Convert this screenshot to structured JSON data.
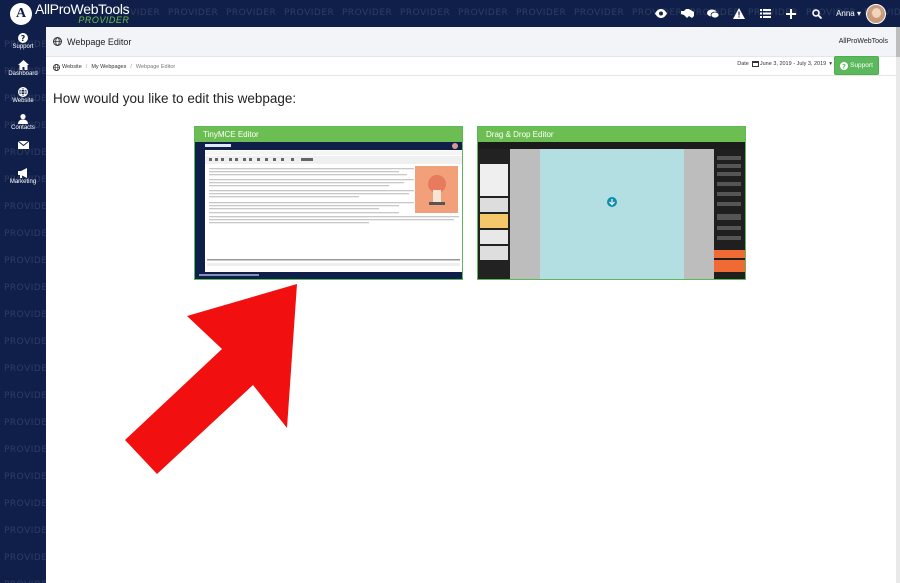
{
  "brand": {
    "name": "AllProWebTools",
    "sub": "PROVIDER",
    "watermark": "PROVIDER"
  },
  "topbar": {
    "icons": [
      "eye-icon",
      "handshake-icon",
      "chat-icon",
      "alert-icon",
      "list-icon",
      "plus-icon",
      "search-icon"
    ],
    "user_name": "Anna"
  },
  "sidebar": {
    "items": [
      {
        "label": "Support",
        "icon": "question-icon"
      },
      {
        "label": "Dashboard",
        "icon": "home-icon"
      },
      {
        "label": "Website",
        "icon": "globe-icon"
      },
      {
        "label": "Contacts",
        "icon": "user-icon"
      },
      {
        "label": "Mail",
        "icon": "envelope-icon"
      },
      {
        "label": "Marketing",
        "icon": "megaphone-icon"
      }
    ]
  },
  "header": {
    "title": "Webpage Editor",
    "brand": "AllProWebTools"
  },
  "breadcrumb": {
    "items": [
      "Website",
      "My Webpages",
      "Webpage Editor"
    ]
  },
  "date_range": {
    "label": "Date",
    "value": "June 3, 2019 - July 3, 2019"
  },
  "support_button": {
    "label": "Support"
  },
  "question": "How would you like to edit this webpage:",
  "editors": [
    {
      "label": "TinyMCE Editor"
    },
    {
      "label": "Drag & Drop Editor"
    }
  ],
  "colors": {
    "navy": "#0f1f4a",
    "green": "#6cbe52",
    "arrow": "#f20f0f",
    "canvas": "#b3dee2"
  }
}
